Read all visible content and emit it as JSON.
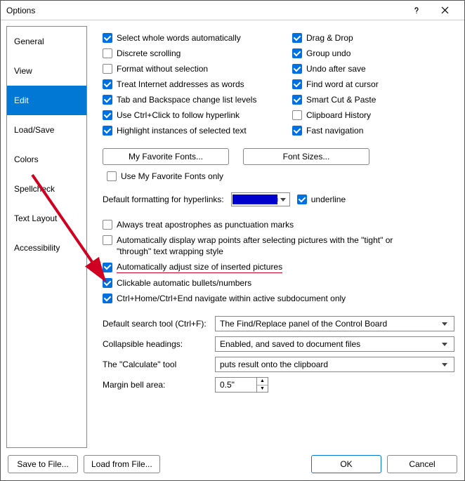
{
  "window": {
    "title": "Options"
  },
  "sidebar": {
    "items": [
      {
        "label": "General"
      },
      {
        "label": "View"
      },
      {
        "label": "Edit",
        "active": true
      },
      {
        "label": "Load/Save"
      },
      {
        "label": "Colors"
      },
      {
        "label": "Spellcheck"
      },
      {
        "label": "Text Layout"
      },
      {
        "label": "Accessibility"
      }
    ]
  },
  "checks_left": [
    {
      "label": "Select whole words automatically",
      "checked": true
    },
    {
      "label": "Discrete scrolling",
      "checked": false
    },
    {
      "label": "Format without selection",
      "checked": false
    },
    {
      "label": "Treat Internet addresses as words",
      "checked": true
    },
    {
      "label": "Tab and Backspace change list levels",
      "checked": true
    },
    {
      "label": "Use Ctrl+Click to follow hyperlink",
      "checked": true
    },
    {
      "label": "Highlight instances of selected text",
      "checked": true
    }
  ],
  "checks_right": [
    {
      "label": "Drag & Drop",
      "checked": true
    },
    {
      "label": "Group undo",
      "checked": true
    },
    {
      "label": "Undo after save",
      "checked": true
    },
    {
      "label": "Find word at cursor",
      "checked": true
    },
    {
      "label": "Smart Cut & Paste",
      "checked": true
    },
    {
      "label": "Clipboard History",
      "checked": false
    },
    {
      "label": "Fast navigation",
      "checked": true
    }
  ],
  "buttons": {
    "fav_fonts": "My Favorite Fonts...",
    "font_sizes": "Font Sizes..."
  },
  "use_fav_fonts_only": {
    "label": "Use My Favorite Fonts only",
    "checked": false
  },
  "hyperlink": {
    "label": "Default formatting for hyperlinks:",
    "color": "#0000cc",
    "underline": {
      "label": "underline",
      "checked": true
    }
  },
  "more_checks": [
    {
      "label": "Always treat apostrophes as punctuation marks",
      "checked": false
    },
    {
      "label": "Automatically display wrap points after selecting pictures with the \"tight\" or \"through\" text wrapping style",
      "checked": false
    },
    {
      "label": "Automatically adjust size of inserted pictures",
      "checked": true,
      "highlight": true
    },
    {
      "label": "Clickable automatic bullets/numbers",
      "checked": true
    },
    {
      "label": "Ctrl+Home/Ctrl+End navigate within active subdocument only",
      "checked": true
    }
  ],
  "form": {
    "search_tool": {
      "label": "Default search tool (Ctrl+F):",
      "value": "The Find/Replace panel of the Control Board"
    },
    "collapsible": {
      "label": "Collapsible headings:",
      "value": "Enabled, and saved to document files"
    },
    "calculate": {
      "label": "The \"Calculate\" tool",
      "value": "puts result onto the clipboard"
    },
    "margin_bell": {
      "label": "Margin bell area:",
      "value": "0.5\""
    }
  },
  "footer": {
    "save_to_file": "Save to File...",
    "load_from_file": "Load from File...",
    "ok": "OK",
    "cancel": "Cancel"
  }
}
